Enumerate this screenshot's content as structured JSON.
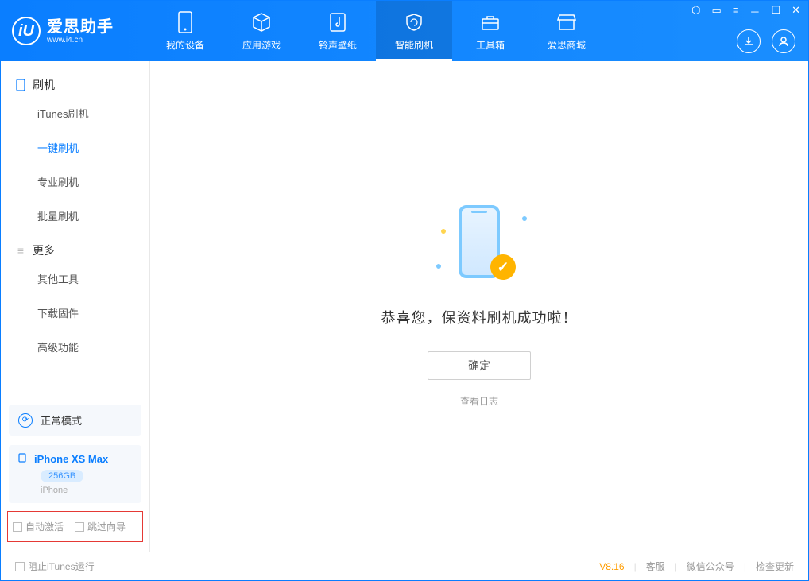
{
  "brand": {
    "name": "爱思助手",
    "url": "www.i4.cn",
    "logo_letter": "iU"
  },
  "nav": {
    "items": [
      {
        "label": "我的设备"
      },
      {
        "label": "应用游戏"
      },
      {
        "label": "铃声壁纸"
      },
      {
        "label": "智能刷机"
      },
      {
        "label": "工具箱"
      },
      {
        "label": "爱思商城"
      }
    ]
  },
  "sidebar": {
    "group_flash": "刷机",
    "items_flash": [
      {
        "label": "iTunes刷机"
      },
      {
        "label": "一键刷机"
      },
      {
        "label": "专业刷机"
      },
      {
        "label": "批量刷机"
      }
    ],
    "group_more": "更多",
    "items_more": [
      {
        "label": "其他工具"
      },
      {
        "label": "下载固件"
      },
      {
        "label": "高级功能"
      }
    ],
    "mode_card": "正常模式",
    "device_name": "iPhone XS Max",
    "device_storage": "256GB",
    "device_type": "iPhone",
    "chk_auto_activate": "自动激活",
    "chk_skip_guide": "跳过向导"
  },
  "main": {
    "success_text": "恭喜您，保资料刷机成功啦！",
    "ok_button": "确定",
    "view_log": "查看日志"
  },
  "footer": {
    "block_itunes": "阻止iTunes运行",
    "version": "V8.16",
    "links": [
      "客服",
      "微信公众号",
      "检查更新"
    ]
  }
}
